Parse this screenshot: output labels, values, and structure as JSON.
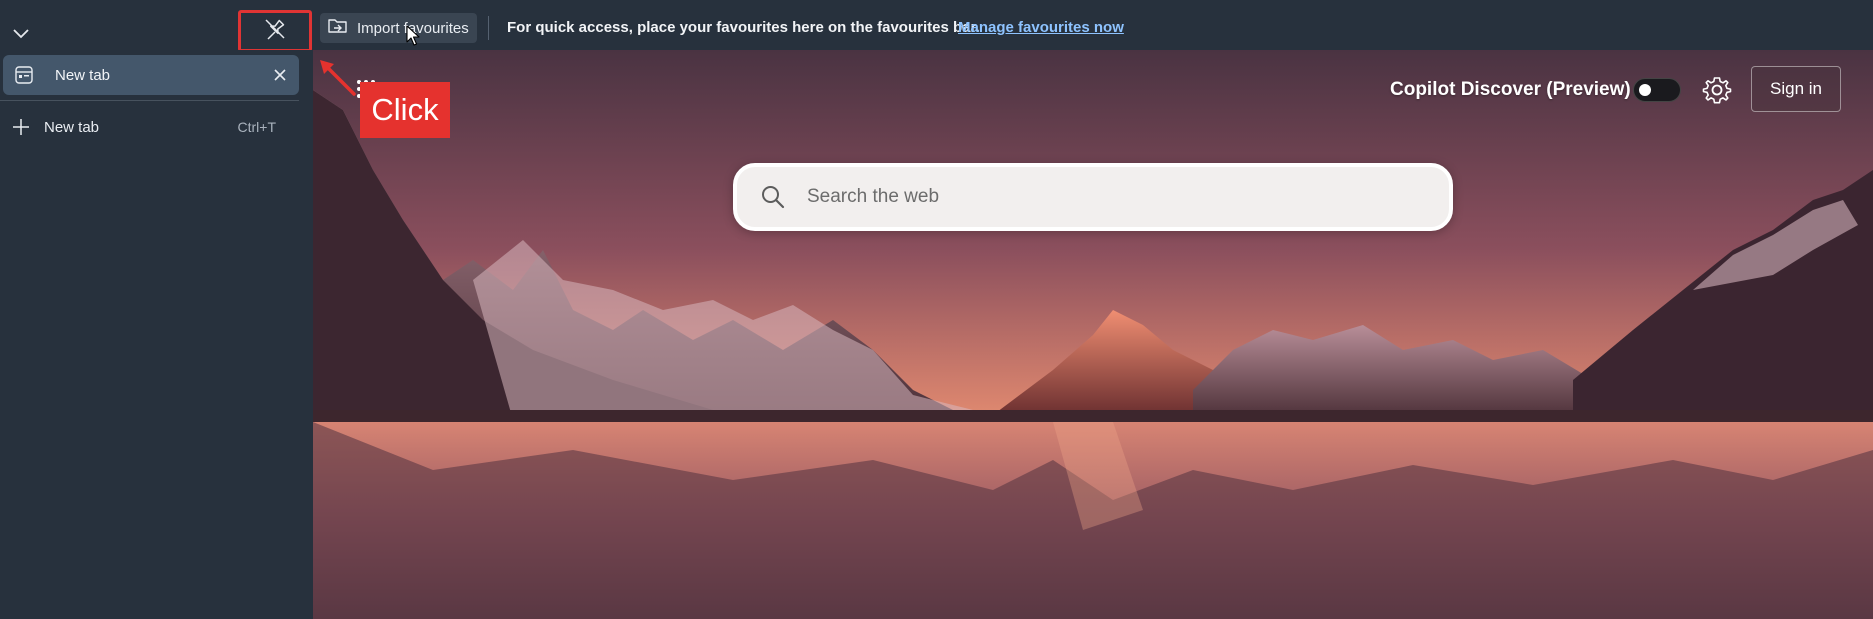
{
  "favourites_bar": {
    "import_label": "Import favourites",
    "hint_text": "For quick access, place your favourites here on the favourites bar.",
    "manage_link": "Manage favourites now"
  },
  "sidebar": {
    "tabs": [
      {
        "label": "New tab",
        "active": true
      }
    ],
    "new_tab": {
      "label": "New tab",
      "shortcut": "Ctrl+T"
    }
  },
  "page": {
    "copilot_label": "Copilot Discover (Preview)",
    "copilot_toggle_on": false,
    "sign_in_label": "Sign in",
    "search_placeholder": "Search the web"
  },
  "annotation": {
    "callout_text": "Click",
    "highlight_color": "#e03434"
  },
  "colors": {
    "sidebar_bg": "#27313d",
    "active_tab_bg": "#44576b",
    "link_color": "#8ec3ff"
  }
}
